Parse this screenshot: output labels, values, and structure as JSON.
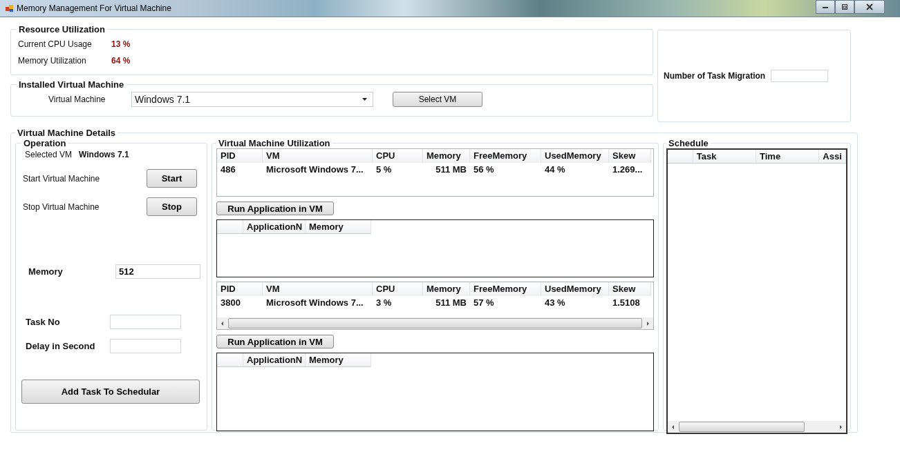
{
  "window": {
    "title": "Memory Management For Virtual Machine"
  },
  "resource_utilization": {
    "title": "Resource Utilization",
    "items": [
      {
        "label": "Current CPU Usage",
        "value": "13 %"
      },
      {
        "label": "Memory Utilization",
        "value": "64  %"
      }
    ]
  },
  "installed_vm": {
    "title": "Installed Virtual Machine",
    "label": "Virtual Machine",
    "value": "Windows 7.1",
    "button": "Select VM"
  },
  "migration": {
    "label": "Number of Task Migration"
  },
  "details": {
    "title": "Virtual Machine Details",
    "operation": {
      "title": "Operation",
      "selected_label": "Selected VM",
      "selected_value": "Windows 7.1",
      "actions": [
        {
          "label": "Start Virtual Machine",
          "button": "Start"
        },
        {
          "label": "Stop Virtual Machine",
          "button": "Stop"
        }
      ],
      "memory": {
        "label": "Memory",
        "value": "512"
      },
      "task_no": {
        "label": "Task No"
      },
      "delay": {
        "label": "Delay in Second"
      },
      "add_button": "Add Task To Schedular"
    },
    "utilization": {
      "title": "Virtual Machine Utilization",
      "vms": [
        {
          "columns": [
            "PID",
            "VM",
            "CPU",
            "Memory",
            "FreeMemory",
            "UsedMemory",
            "Skew"
          ],
          "rows": [
            [
              "486",
              "Microsoft Windows 7...",
              "5 %",
              "511 MB",
              "56 %",
              "44 %",
              "1.269..."
            ]
          ],
          "scrollbar": false,
          "run_button": "Run Application in VM",
          "app_columns": [
            "ApplicationN",
            "Memory"
          ]
        },
        {
          "columns": [
            "PID",
            "VM",
            "CPU",
            "Memory",
            "FreeMemory",
            "UsedMemory",
            "Skew"
          ],
          "rows": [
            [
              "3800",
              "Microsoft Windows 7...",
              "3 %",
              "511 MB",
              "57 %",
              "43 %",
              "1.5108"
            ]
          ],
          "scrollbar": true,
          "run_button": "Run Application in VM",
          "app_columns": [
            "ApplicationN",
            "Memory"
          ]
        }
      ]
    },
    "schedule": {
      "title": "Schedule",
      "columns": [
        "Task",
        "Time",
        "Assi"
      ]
    }
  }
}
